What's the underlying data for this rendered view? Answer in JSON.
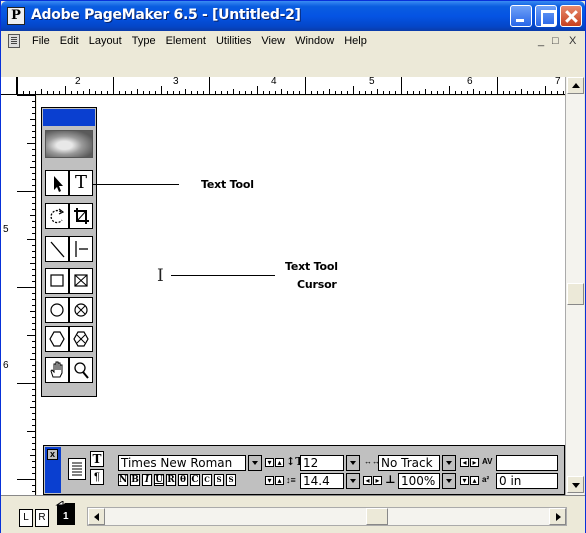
{
  "window": {
    "title": "Adobe PageMaker 6.5 - [Untitled-2]",
    "app_icon": "P"
  },
  "menu": {
    "items": [
      "File",
      "Edit",
      "Layout",
      "Type",
      "Element",
      "Utilities",
      "View",
      "Window",
      "Help"
    ],
    "minimize_glyph": "_",
    "restore_glyph": "̅□",
    "close_glyph": "X"
  },
  "ruler": {
    "top_numbers": [
      "2",
      "3",
      "4",
      "5",
      "6",
      "7"
    ],
    "left_numbers": [
      "5",
      "6"
    ]
  },
  "annotations": {
    "text_tool_label": "Text Tool",
    "cursor_label_line1": "Text Tool",
    "cursor_label_line2": "Cursor"
  },
  "toolbox": {
    "tools": [
      [
        "pointer-tool",
        "text-tool"
      ],
      [
        "rotate-tool",
        "crop-tool"
      ],
      [
        "line-tool",
        "constrained-line-tool"
      ],
      [
        "rectangle-tool",
        "rectangle-frame-tool"
      ],
      [
        "ellipse-tool",
        "ellipse-frame-tool"
      ],
      [
        "polygon-tool",
        "polygon-frame-tool"
      ],
      [
        "hand-tool",
        "zoom-tool"
      ]
    ],
    "text_glyph": "T"
  },
  "control_palette": {
    "char_icon": "T",
    "para_icon": "¶",
    "font": "Times New Roman",
    "font_size": "12",
    "leading": "14.4",
    "track": "No Track",
    "scale": "100%",
    "baseline_shift": "0 in",
    "kerning": "",
    "style_buttons": [
      "N",
      "B",
      "I",
      "U",
      "R",
      "θ",
      "C",
      "C",
      "S",
      "S"
    ]
  },
  "bottom": {
    "master_left": "L",
    "master_right": "R",
    "page_number": "1"
  },
  "colors": {
    "title_bar": "#0554e3",
    "palette_title": "#0a3fd0",
    "palette_bg": "#c0c0c0"
  }
}
